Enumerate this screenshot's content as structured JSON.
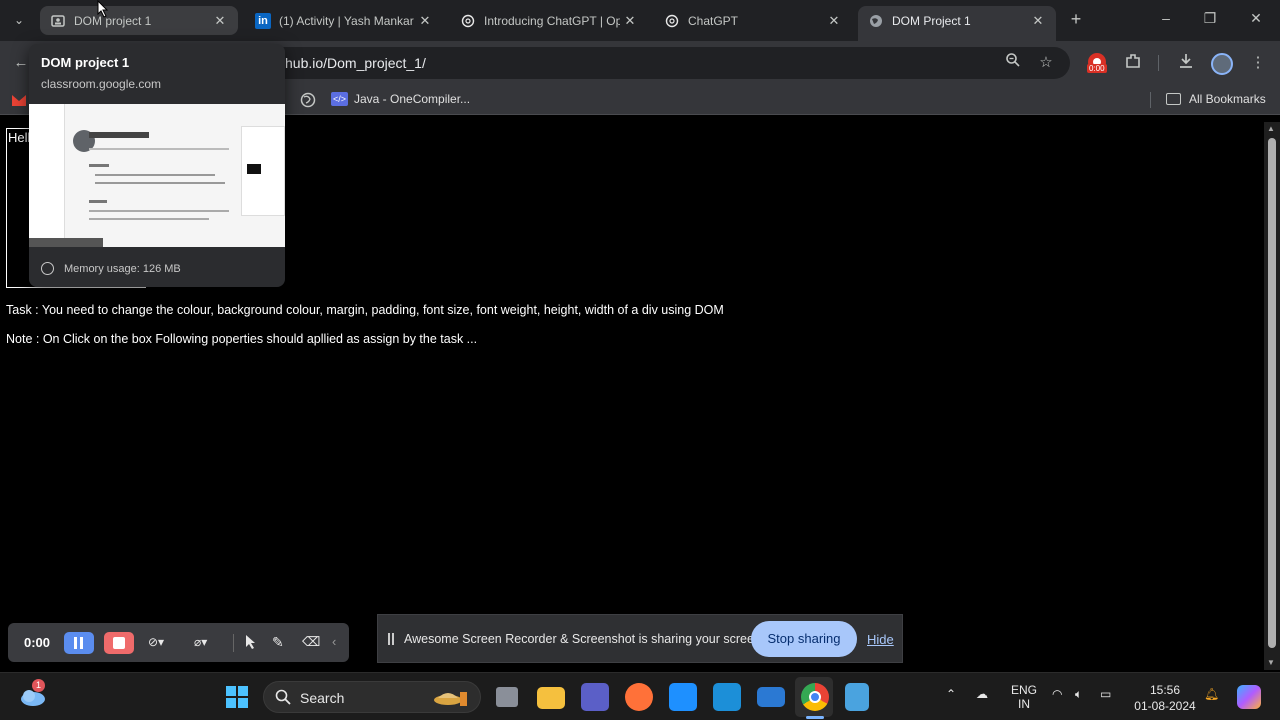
{
  "tabs": [
    {
      "title": "DOM project 1",
      "favicon": "classroom-icon"
    },
    {
      "title": "(1) Activity | Yash Mankar",
      "favicon": "linkedin-icon"
    },
    {
      "title": "Introducing ChatGPT | Op",
      "favicon": "openai-icon"
    },
    {
      "title": "ChatGPT",
      "favicon": "openai-icon"
    },
    {
      "title": "DOM Project 1",
      "favicon": "globe-icon"
    }
  ],
  "address_bar": {
    "url": "hub.io/Dom_project_1/"
  },
  "recorder_badge": "0:00",
  "bookmarks": {
    "items": [
      {
        "label": "Java - OneCompiler..."
      }
    ],
    "all_bookmarks": "All Bookmarks"
  },
  "hover_card": {
    "title": "DOM project 1",
    "domain": "classroom.google.com",
    "memory": "Memory usage: 126 MB"
  },
  "page": {
    "box_text": "Hell",
    "task": "Task : You need to change the colour, background colour, margin, padding, font size, font weight, height, width of a div using DOM",
    "note": "Note : On Click on the box Following poperties should apllied as assign by the task ..."
  },
  "recorder": {
    "time": "0:00"
  },
  "share_banner": {
    "text": "Awesome Screen Recorder & Screenshot is sharing your screen.",
    "stop": "Stop sharing",
    "hide": "Hide"
  },
  "taskbar": {
    "search": "Search",
    "notification_count": "1",
    "lang_top": "ENG",
    "lang_bottom": "IN",
    "time": "15:56",
    "date": "01-08-2024"
  },
  "colors": {
    "tabstrip": "#202124",
    "toolbar": "#35363a",
    "accent_button": "#a8c7fa",
    "page_bg": "#000000"
  }
}
